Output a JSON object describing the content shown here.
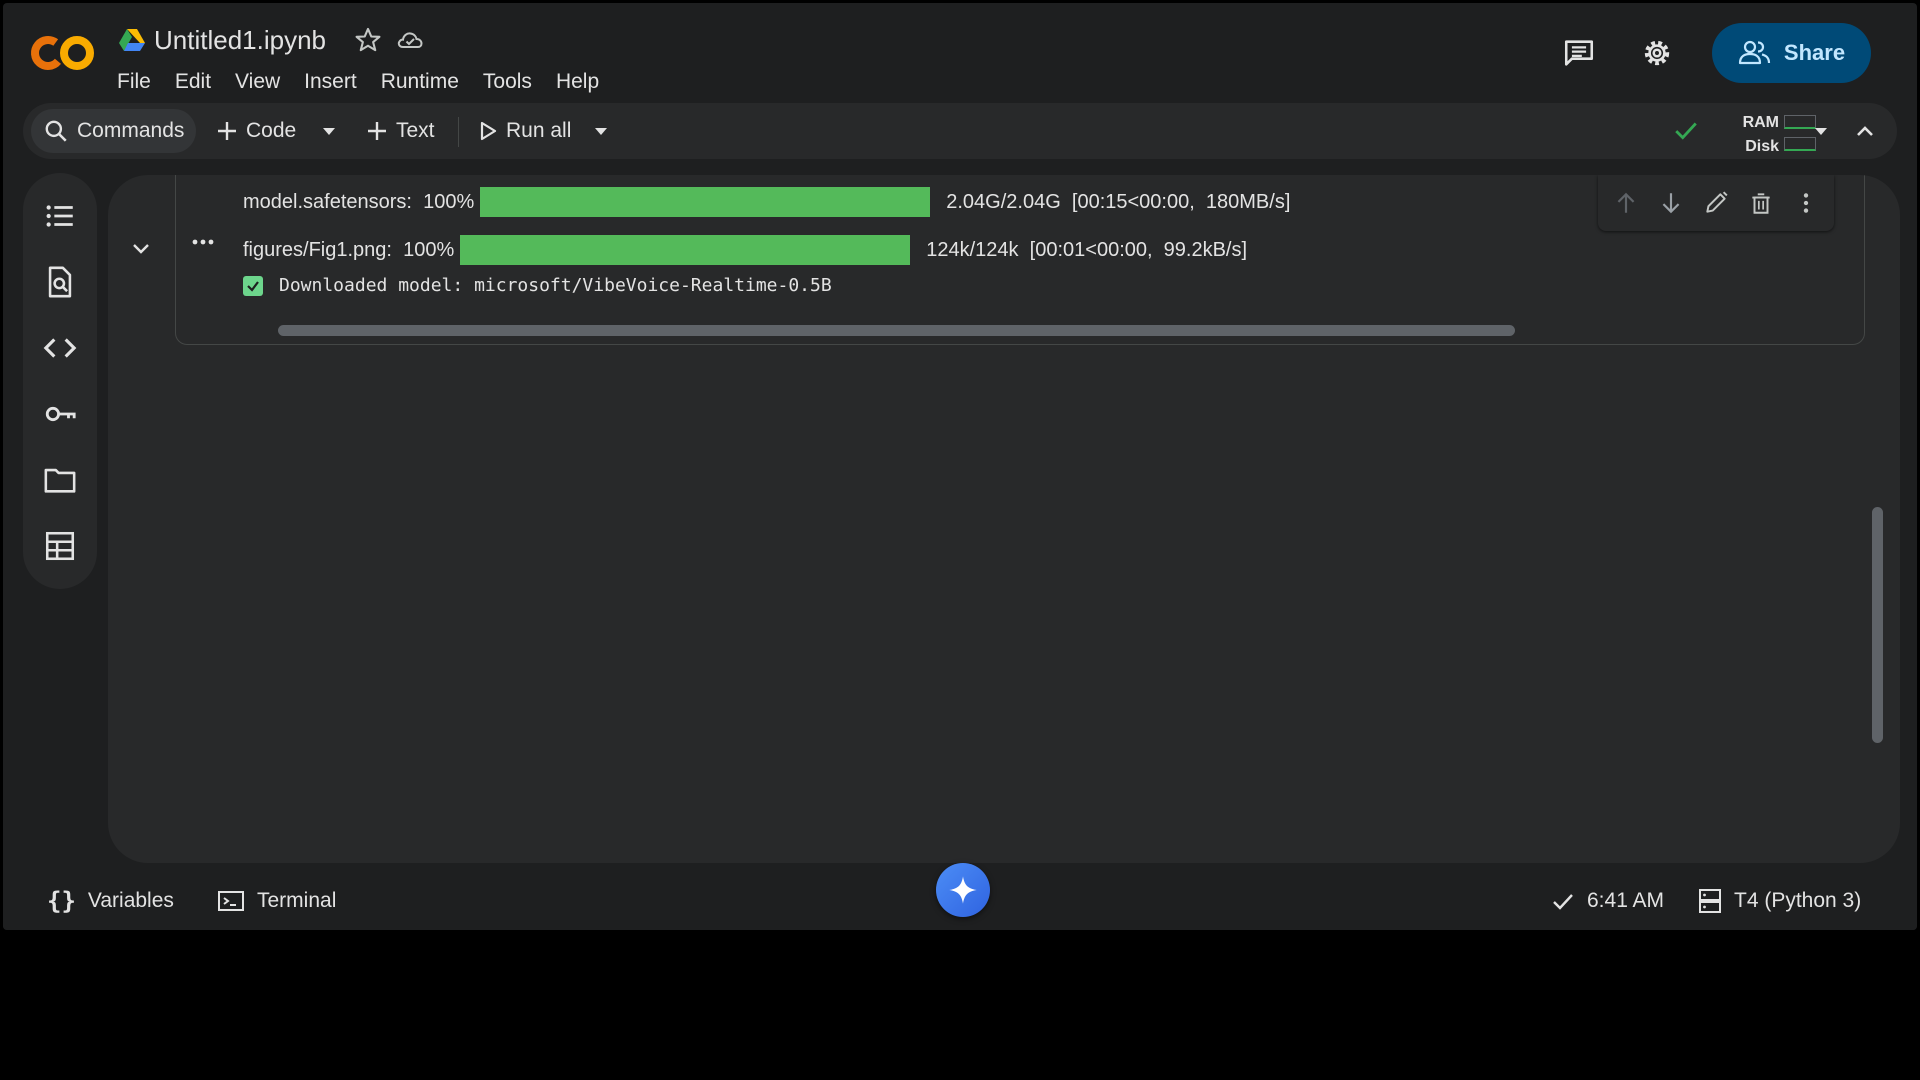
{
  "header": {
    "app_logo": "colab-logo",
    "doc_title": "Untitled1.ipynb",
    "menu": [
      "File",
      "Edit",
      "View",
      "Insert",
      "Runtime",
      "Tools",
      "Help"
    ],
    "share_label": "Share"
  },
  "toolbar": {
    "commands_label": "Commands",
    "code_label": "Code",
    "text_label": "Text",
    "run_all_label": "Run all",
    "ram_label": "RAM",
    "disk_label": "Disk"
  },
  "left_rail": {
    "icons": [
      "table-of-contents-icon",
      "find-replace-icon",
      "code-snippets-icon",
      "secrets-key-icon",
      "files-folder-icon",
      "data-table-icon"
    ]
  },
  "cell_output": {
    "rows": [
      {
        "name": "model.safetensors",
        "percent_text": "100%",
        "progress": 1.0,
        "stats": "2.04G/2.04G  [00:15<00:00,  180MB/s]"
      },
      {
        "name": "figures/Fig1.png",
        "percent_text": "100%",
        "progress": 1.0,
        "stats": "124k/124k  [00:01<00:00,  99.2kB/s]"
      }
    ],
    "download_message": "Downloaded model: microsoft/VibeVoice-Realtime-0.5B"
  },
  "status_bar": {
    "variables_label": "Variables",
    "terminal_label": "Terminal",
    "time": "6:41 AM",
    "runtime": "T4 (Python 3)"
  },
  "colors": {
    "background": "#1e1f20",
    "surface": "#28292a",
    "progress_green": "#54ba5a",
    "share_bg": "#004a77",
    "share_text": "#c2e7ff",
    "logo_orange": "#f9ab00",
    "logo_dark_orange": "#e8710a",
    "gemini_blue": "#4c8df6"
  }
}
